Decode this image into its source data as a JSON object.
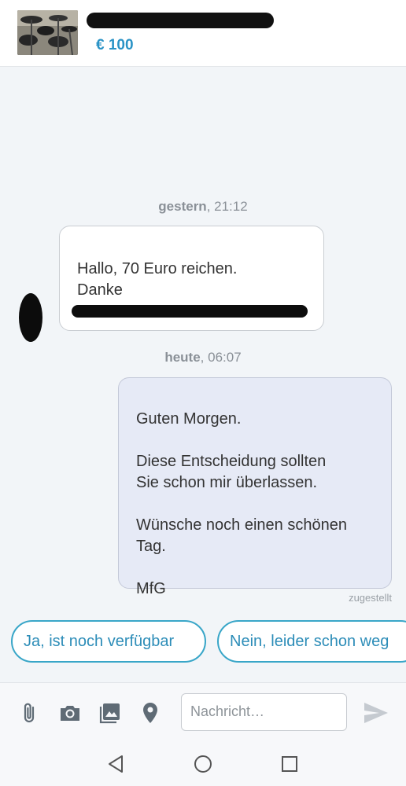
{
  "listing": {
    "price": "€ 100"
  },
  "messages": [
    {
      "date_day": "gestern",
      "date_time": ", 21:12",
      "direction": "incoming",
      "text": "Hallo, 70 Euro reichen.\nDanke"
    },
    {
      "date_day": "heute",
      "date_time": ", 06:07",
      "direction": "outgoing",
      "text": "Guten Morgen.\n\nDiese Entscheidung sollten\nSie schon mir überlassen.\n\nWünsche noch einen schönen\nTag.\n\nMfG",
      "status": "zugestellt"
    }
  ],
  "quick_replies": [
    "Ja, ist noch verfügbar",
    "Nein, leider schon weg"
  ],
  "composer": {
    "placeholder": "Nachricht…",
    "icons": [
      "paperclip-icon",
      "camera-icon",
      "gallery-icon",
      "location-pin-icon",
      "send-icon"
    ]
  },
  "navigation": {
    "icons": [
      "back-icon",
      "home-icon",
      "recents-icon"
    ]
  },
  "colors": {
    "accent": "#2a93c6",
    "outgoing_bubble": "#e6eaf6",
    "background": "#f2f5f8"
  }
}
